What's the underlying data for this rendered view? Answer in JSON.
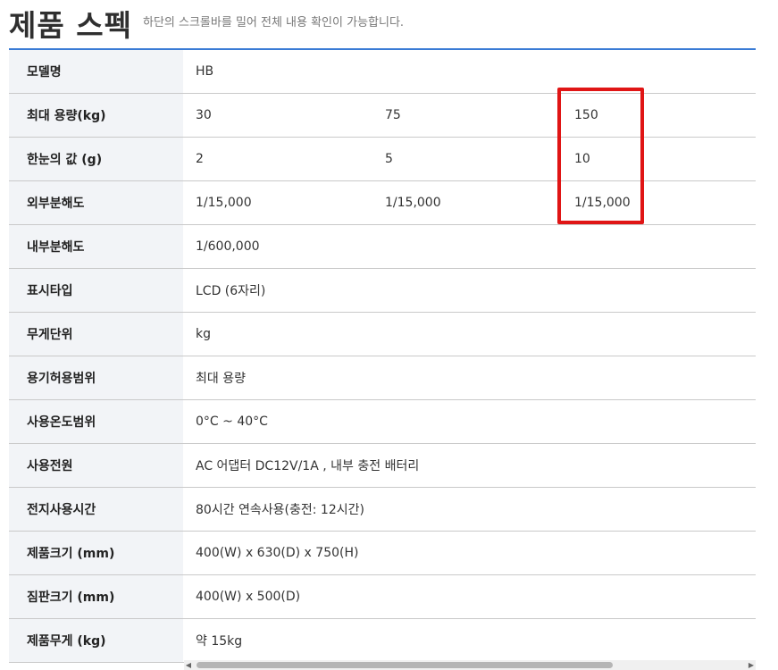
{
  "header": {
    "title": "제품 스펙",
    "subtitle": "하단의 스크롤바를 밀어 전체 내용 확인이 가능합니다."
  },
  "spec_rows": [
    {
      "label": "모델명",
      "values": [
        "HB"
      ]
    },
    {
      "label": "최대 용량(kg)",
      "values": [
        "30",
        "75",
        "150"
      ]
    },
    {
      "label": "한눈의 값 (g)",
      "values": [
        "2",
        "5",
        "10"
      ]
    },
    {
      "label": "외부분해도",
      "values": [
        "1/15,000",
        "1/15,000",
        "1/15,000"
      ]
    },
    {
      "label": "내부분해도",
      "values": [
        "1/600,000"
      ]
    },
    {
      "label": "표시타입",
      "values": [
        "LCD (6자리)"
      ]
    },
    {
      "label": "무게단위",
      "values": [
        "kg"
      ]
    },
    {
      "label": "용기허용범위",
      "values": [
        "최대 용량"
      ]
    },
    {
      "label": "사용온도범위",
      "values": [
        "0°C ~ 40°C"
      ]
    },
    {
      "label": "사용전원",
      "values": [
        "AC 어댑터 DC12V/1A , 내부 충전 배터리"
      ]
    },
    {
      "label": "전지사용시간",
      "values": [
        "80시간 연속사용(충전: 12시간)"
      ]
    },
    {
      "label": "제품크기 (mm)",
      "values": [
        "400(W) x 630(D) x 750(H)"
      ]
    },
    {
      "label": "짐판크기 (mm)",
      "values": [
        "400(W) x 500(D)"
      ]
    },
    {
      "label": "제품무게 (kg)",
      "values": [
        "약 15kg"
      ]
    }
  ],
  "scrollbar": {
    "left_arrow": "◀",
    "right_arrow": "▶"
  },
  "colors": {
    "accent_line": "#3a7bd5",
    "highlight_box": "#e01515",
    "label_bg": "#f2f4f7"
  }
}
